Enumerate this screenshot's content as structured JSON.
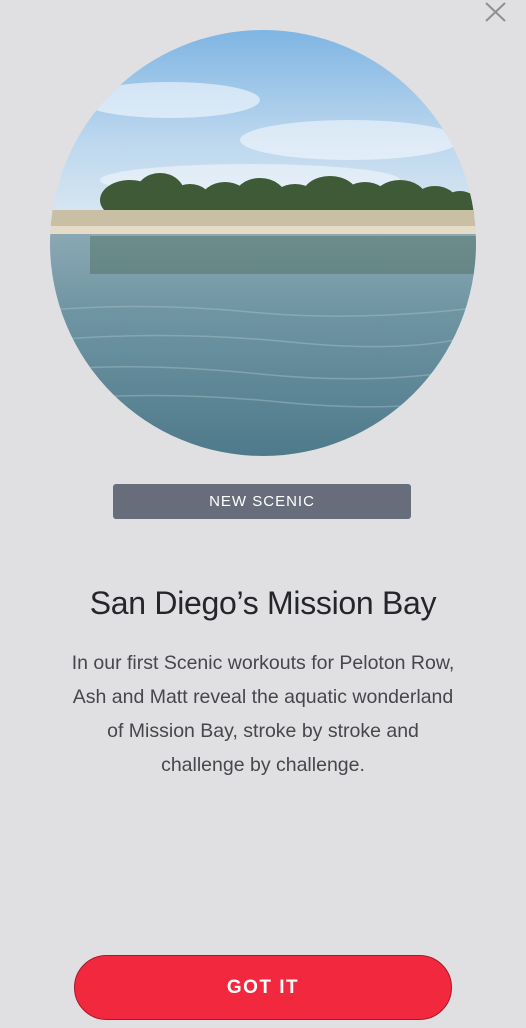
{
  "modal": {
    "close_icon": "close-icon",
    "hero_image_alt": "",
    "badge": "NEW SCENIC",
    "title": "San Diego’s Mission Bay",
    "description_lines": [
      "In our first Scenic workouts for Peloton Row,",
      "Ash and Matt reveal the aquatic wonderland",
      "of Mission Bay, stroke by stroke and",
      "challenge by challenge."
    ],
    "cta_label": "GOT IT"
  },
  "colors": {
    "background": "#e0e0e2",
    "badge_bg": "#686d7c",
    "cta_bg": "#f2283e",
    "title_text": "#25262b",
    "body_text": "#46474d"
  }
}
